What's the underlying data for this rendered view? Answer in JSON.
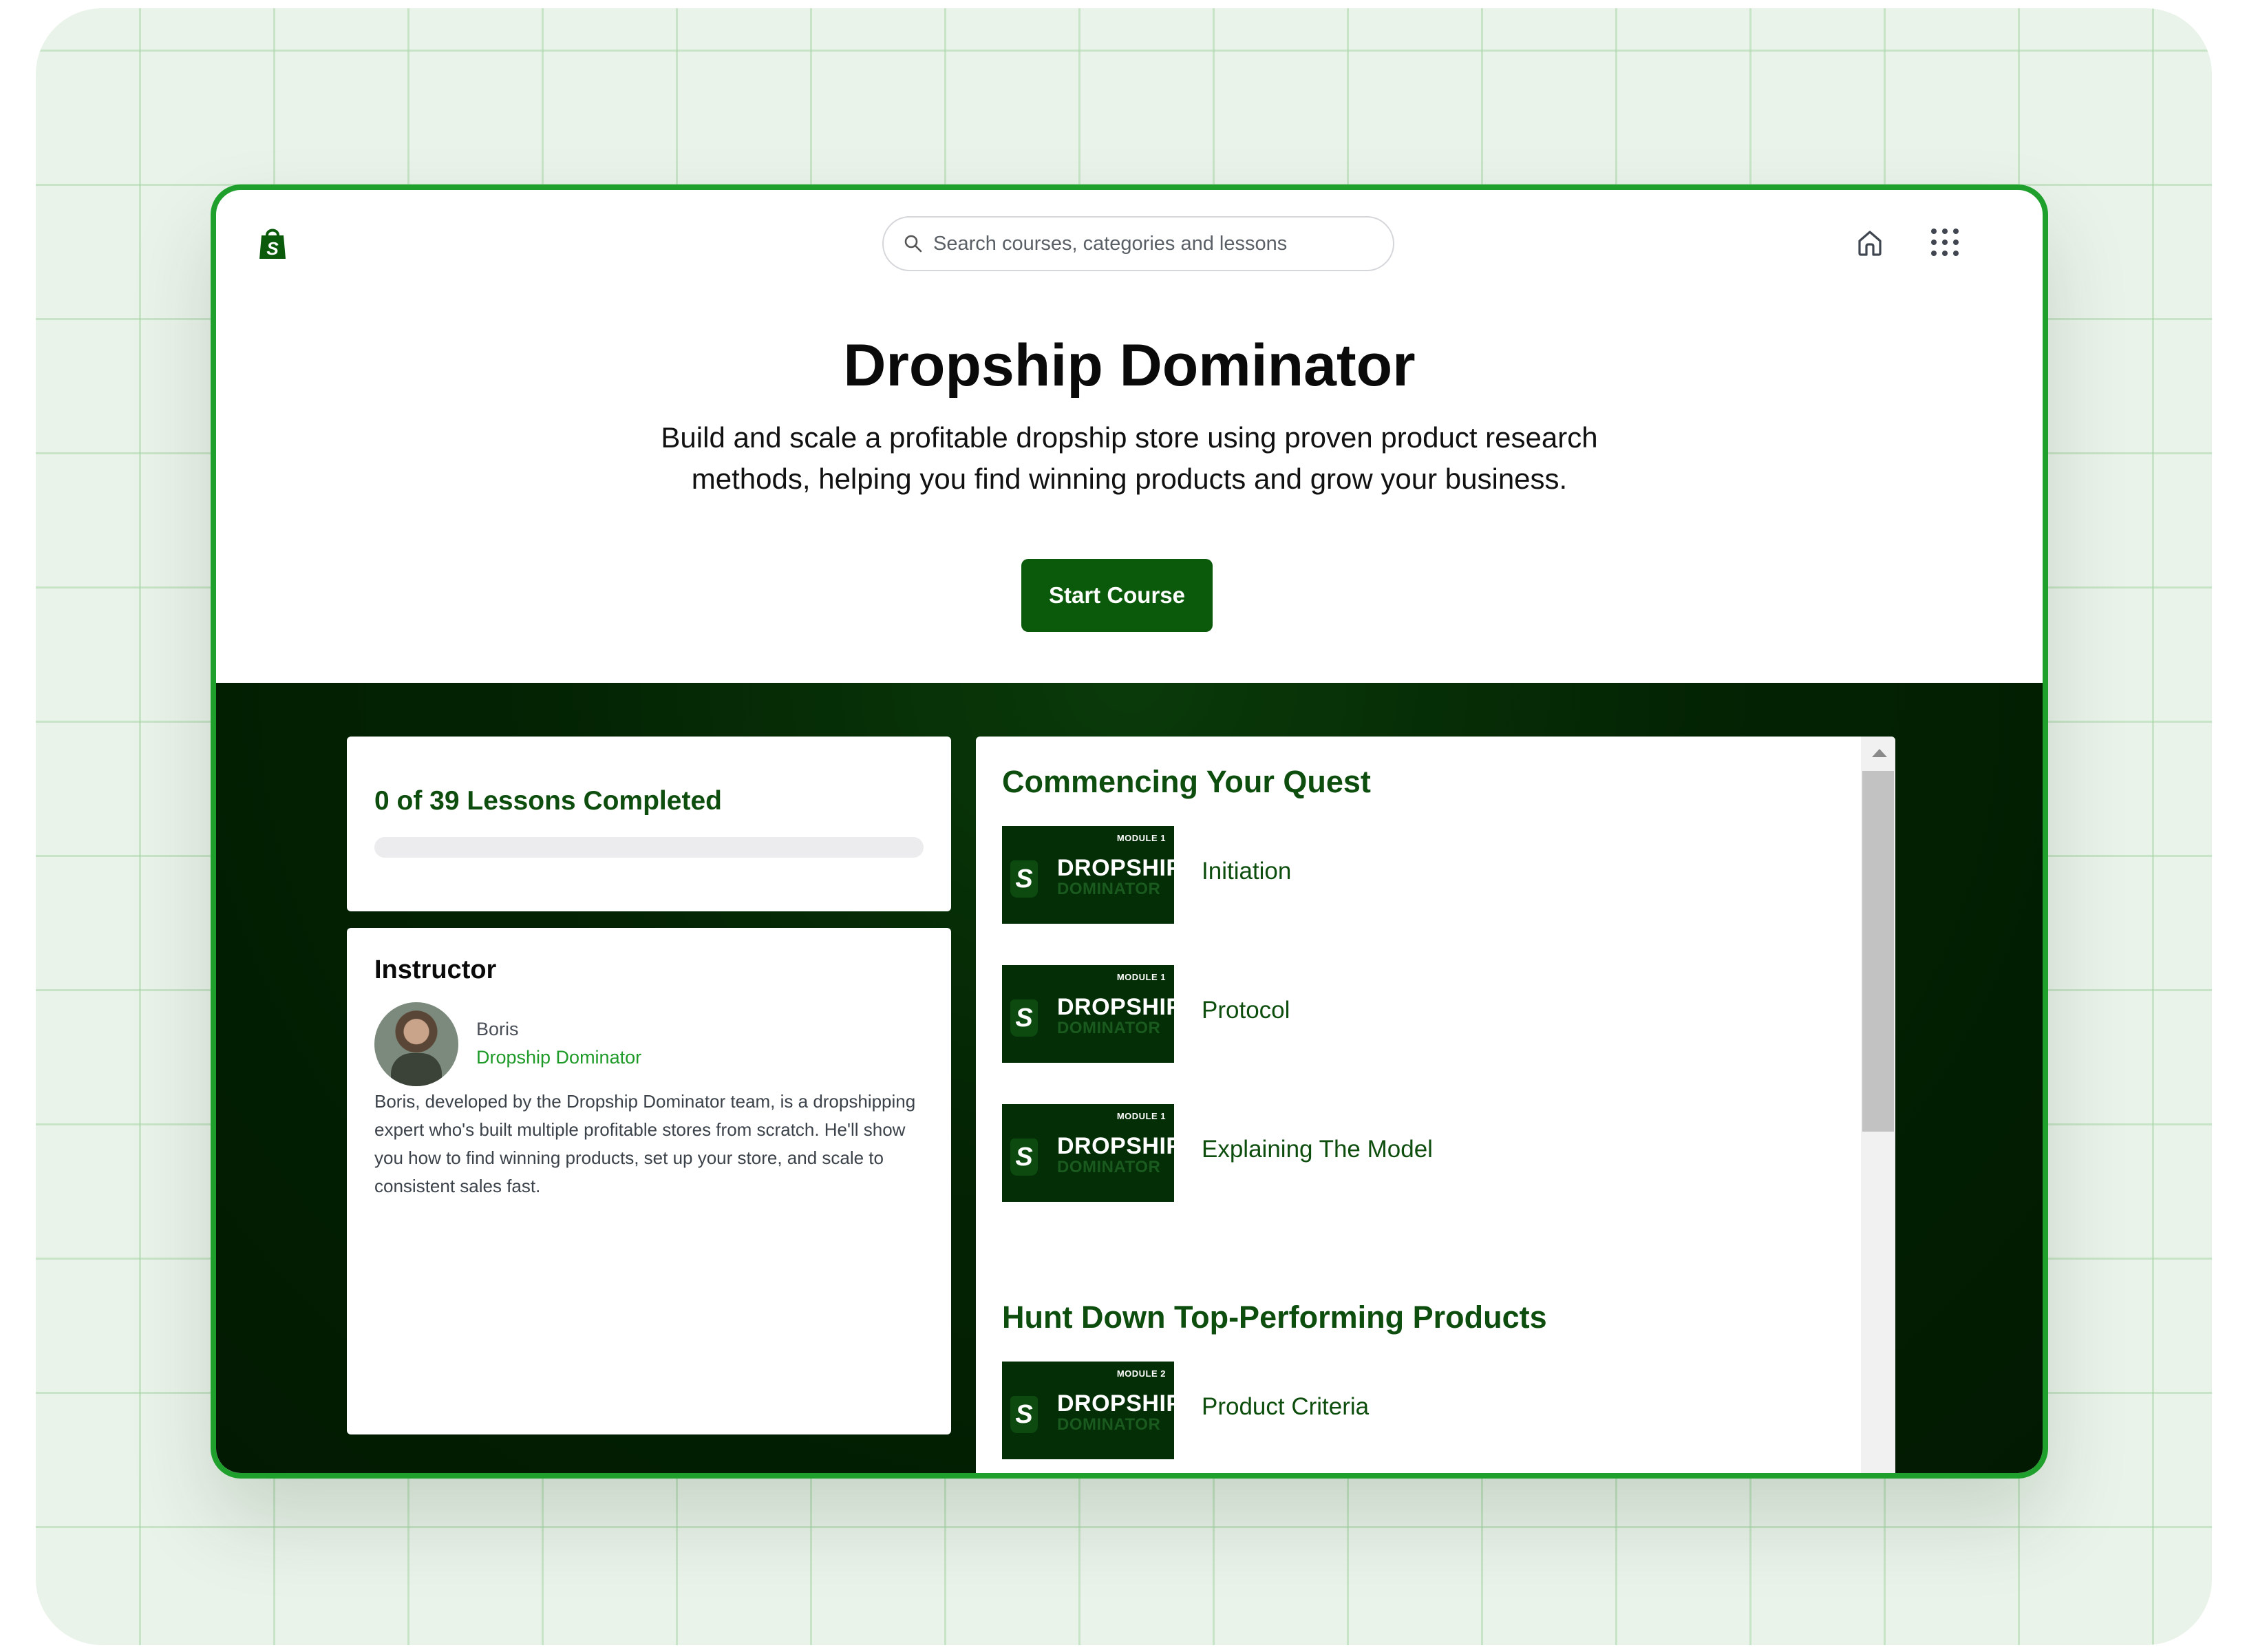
{
  "search": {
    "placeholder": "Search courses, categories and lessons"
  },
  "hero": {
    "title": "Dropship Dominator",
    "description": "Build and scale a profitable dropship store using proven product research methods, helping you find winning products and grow your business.",
    "start_label": "Start Course"
  },
  "progress": {
    "label": "0 of 39 Lessons Completed",
    "completed": 0,
    "total": 39,
    "fraction": 0
  },
  "instructor": {
    "heading": "Instructor",
    "name": "Boris",
    "organization": "Dropship Dominator",
    "bio": "Boris, developed by the Dropship Dominator team, is a dropshipping expert who's built multiple profitable stores from scratch. He'll show you how to find winning products, set up your store, and scale to consistent sales fast."
  },
  "thumbnail": {
    "brand_top": "DROPSHIP",
    "brand_bottom": "DOMINATOR",
    "logo_letter": "S"
  },
  "modules": [
    {
      "title": "Commencing Your Quest",
      "tag": "MODULE 1",
      "lessons": [
        "Initiation",
        "Protocol",
        "Explaining The Model"
      ]
    },
    {
      "title": "Hunt Down Top-Performing Products",
      "tag": "MODULE 2",
      "lessons": [
        "Product Criteria"
      ]
    }
  ],
  "icons": [
    "shopify-logo-icon",
    "search-icon",
    "home-icon",
    "apps-grid-icon"
  ],
  "colors": {
    "brand_green": "#0b5a0b",
    "accent_green": "#1fa02c",
    "dark_bg": "#032303"
  }
}
